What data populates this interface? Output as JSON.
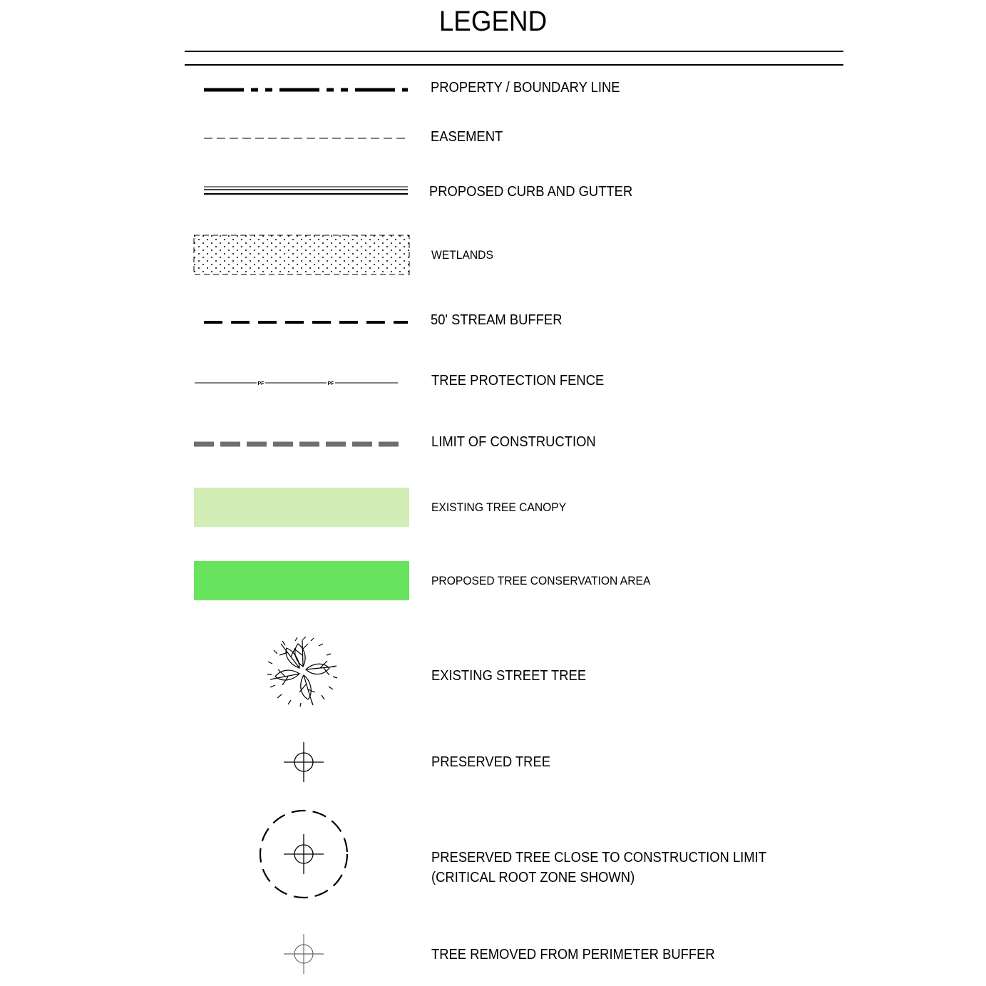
{
  "title": "LEGEND",
  "colors": {
    "existing_canopy": "#d2edb6",
    "conservation_area": "#68e35e",
    "limit_of_construction": "#6e6e6e"
  },
  "items": [
    {
      "label": "PROPERTY / BOUNDARY LINE",
      "symbol": "dash-dot-heavy-line"
    },
    {
      "label": "EASEMENT",
      "symbol": "thin-dashed-line"
    },
    {
      "label": "PROPOSED  CURB AND GUTTER",
      "symbol": "triple-line"
    },
    {
      "label": "WETLANDS",
      "symbol": "dotted-hatch-box"
    },
    {
      "label": "50' STREAM BUFFER",
      "symbol": "heavy-dashed-line"
    },
    {
      "label": "TREE PROTECTION FENCE",
      "symbol": "fence-line",
      "marker": "PF"
    },
    {
      "label": "LIMIT OF CONSTRUCTION",
      "symbol": "gray-dashed-line"
    },
    {
      "label": "EXISTING TREE CANOPY",
      "symbol": "light-green-swatch"
    },
    {
      "label": "PROPOSED TREE CONSERVATION AREA",
      "symbol": "green-swatch"
    },
    {
      "label": "EXISTING STREET TREE",
      "symbol": "tree-icon"
    },
    {
      "label": "PRESERVED TREE",
      "symbol": "crosshair-icon"
    },
    {
      "label": "PRESERVED TREE CLOSE TO CONSTRUCTION LIMIT",
      "label2": "(CRITICAL ROOT ZONE SHOWN)",
      "symbol": "crosshair-circle-icon"
    },
    {
      "label": "TREE REMOVED FROM PERIMETER BUFFER",
      "symbol": "thin-crosshair-icon"
    }
  ]
}
